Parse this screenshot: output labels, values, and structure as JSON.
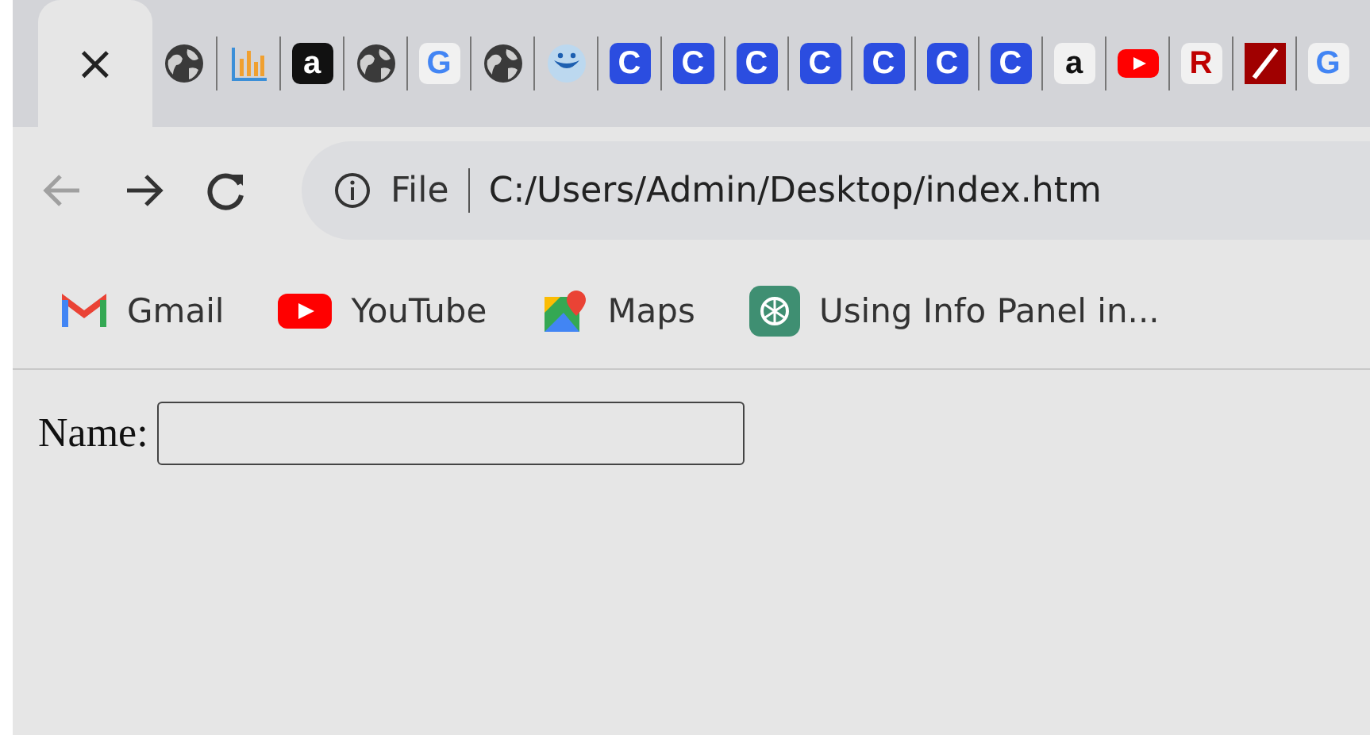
{
  "tabs": [
    {
      "kind": "close",
      "glyph": "×",
      "selected": true
    },
    {
      "kind": "globe",
      "selected": false
    },
    {
      "kind": "chart",
      "selected": false
    },
    {
      "kind": "dark-letter",
      "glyph": "a",
      "selected": false
    },
    {
      "kind": "globe",
      "selected": false
    },
    {
      "kind": "google-letter",
      "glyph": "G",
      "selected": false
    },
    {
      "kind": "globe",
      "selected": false
    },
    {
      "kind": "smile",
      "selected": false
    },
    {
      "kind": "blue-letter",
      "glyph": "C",
      "selected": false
    },
    {
      "kind": "blue-letter",
      "glyph": "C",
      "selected": false
    },
    {
      "kind": "blue-letter",
      "glyph": "C",
      "selected": false
    },
    {
      "kind": "blue-letter",
      "glyph": "C",
      "selected": false
    },
    {
      "kind": "blue-letter",
      "glyph": "C",
      "selected": false
    },
    {
      "kind": "blue-letter",
      "glyph": "C",
      "selected": false
    },
    {
      "kind": "blue-letter",
      "glyph": "C",
      "selected": false
    },
    {
      "kind": "light-letter",
      "glyph": "a",
      "selected": false
    },
    {
      "kind": "youtube",
      "selected": false
    },
    {
      "kind": "red-letter",
      "glyph": "R",
      "selected": false
    },
    {
      "kind": "slash",
      "selected": false
    },
    {
      "kind": "google-letter",
      "glyph": "G",
      "selected": false
    }
  ],
  "toolbar": {
    "back_disabled": true,
    "site_info": "File",
    "url": "C:/Users/Admin/Desktop/index.htm"
  },
  "bookmarks": [
    {
      "kind": "gmail",
      "label": "Gmail"
    },
    {
      "kind": "youtube",
      "label": "YouTube"
    },
    {
      "kind": "maps",
      "label": "Maps"
    },
    {
      "kind": "chatgpt",
      "label": "Using Info Panel in..."
    }
  ],
  "form": {
    "label": "Name:"
  }
}
